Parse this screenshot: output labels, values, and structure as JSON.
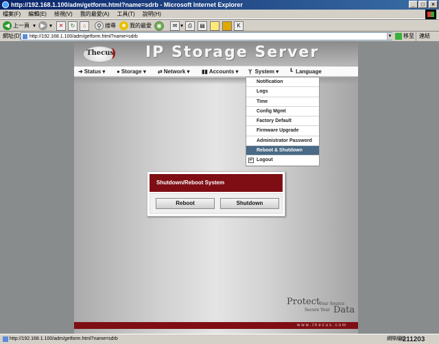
{
  "window": {
    "title": "http://192.168.1.100/adm/getform.html?name=sdrb - Microsoft Internet Explorer",
    "min": "_",
    "max": "□",
    "close": "×"
  },
  "menubar": [
    "檔案(F)",
    "編輯(E)",
    "檢視(V)",
    "我的最愛(A)",
    "工具(T)",
    "說明(H)"
  ],
  "toolbar": {
    "back": "上一頁",
    "search": "搜尋",
    "favorites": "我的最愛"
  },
  "address": {
    "label": "網址(D)",
    "url": "http://192.168.1.100/adm/getform.html?name=sdrb",
    "go": "移至",
    "links": "連結"
  },
  "header": {
    "logo": "Thecus",
    "brand": "IP Storage Server"
  },
  "nav": [
    {
      "label": "Status",
      "icon": "status-icon"
    },
    {
      "label": "Storage",
      "icon": "storage-icon"
    },
    {
      "label": "Network",
      "icon": "network-icon"
    },
    {
      "label": "Accounts",
      "icon": "accounts-icon"
    },
    {
      "label": "System",
      "icon": "system-icon"
    },
    {
      "label": "Language",
      "icon": "language-icon"
    }
  ],
  "system_menu": {
    "items": [
      "Notification",
      "Logs",
      "Time",
      "Config Mgmt",
      "Factory Default",
      "Firmware Upgrade",
      "Administrator Password",
      "Reboot & Shutdown"
    ],
    "selected": "Reboot & Shutdown",
    "logout": "Logout"
  },
  "panel": {
    "title": "Shutdown/Reboot System",
    "reboot": "Reboot",
    "shutdown": "Shutdown"
  },
  "slogan": {
    "protect": "Protect",
    "your_source": "Your Source",
    "secure_your": "Secure Your",
    "data": "Data"
  },
  "footer": {
    "url": "www.thecus.com"
  },
  "statusbar": {
    "url": "http://192.168.1.100/adm/getform.html?name=sdrb",
    "zone": "網際網路",
    "stamp": "#211203"
  },
  "colors": {
    "accent": "#7e0e14",
    "selected": "#4a6a86"
  }
}
